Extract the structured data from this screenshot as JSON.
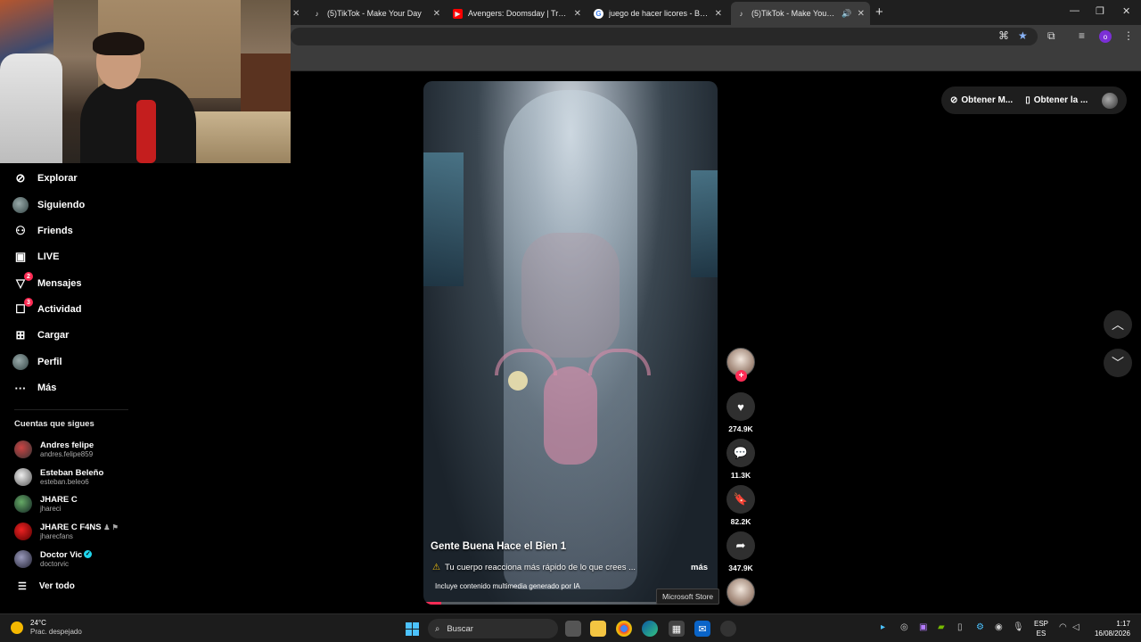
{
  "browser": {
    "tabs": [
      {
        "title": "(5)TikTok - Make Your Day",
        "icon": "tiktok-icon",
        "active": false
      },
      {
        "title": "Avengers: Doomsday | Tráiler O",
        "icon": "youtube-icon",
        "active": false
      },
      {
        "title": "juego de hacer licores - Buscar",
        "icon": "google-icon",
        "active": false
      },
      {
        "title": "(5)TikTok - Make Your Day",
        "icon": "tiktok-icon",
        "active": true
      }
    ],
    "new_tab": "+",
    "profile_initial": "o"
  },
  "sidebar": {
    "nav": [
      {
        "label": "Explorar",
        "icon": "compass-icon"
      },
      {
        "label": "Siguiendo",
        "icon": "avatar-icon"
      },
      {
        "label": "Friends",
        "icon": "people-icon"
      },
      {
        "label": "LIVE",
        "icon": "live-icon"
      },
      {
        "label": "Mensajes",
        "icon": "send-icon",
        "badge": "2"
      },
      {
        "label": "Actividad",
        "icon": "activity-icon",
        "badge": "3"
      },
      {
        "label": "Cargar",
        "icon": "upload-icon"
      },
      {
        "label": "Perfil",
        "icon": "profile-avatar-icon"
      },
      {
        "label": "Más",
        "icon": "more-icon"
      }
    ],
    "following_title": "Cuentas que sigues",
    "following": [
      {
        "name": "Andres felipe",
        "username": "andres.felipe859"
      },
      {
        "name": "Esteban Beleño",
        "username": "esteban.beleo6"
      },
      {
        "name": "JHARE C",
        "username": "jhareci"
      },
      {
        "name": "JHARE C F4NS",
        "username": "jharecfans"
      },
      {
        "name": "Doctor Vic",
        "username": "doctorvic"
      }
    ],
    "see_all": "Ver todo"
  },
  "video": {
    "caption": "Gente Buena Hace el Bien 1",
    "description": "Tu cuerpo reacciona más rápido de lo que crees ...",
    "more": "más",
    "ai_label": "Incluye contenido multimedia generado por IA",
    "progress": 0.06
  },
  "actions": {
    "likes": "274.9K",
    "comments": "11.3K",
    "saves": "82.2K",
    "shares": "347.9K"
  },
  "tooltip": "Microsoft Store",
  "top_actions": {
    "get_app_1": "Obtener M...",
    "get_app_2": "Obtener la ..."
  },
  "taskbar": {
    "temperature": "24°C",
    "weather": "Prac. despejado",
    "search_placeholder": "Buscar",
    "lang_1": "ESP",
    "lang_2": "ES",
    "time": "1:17",
    "date": "16/08/2026"
  },
  "colors": {
    "accent": "#fe2c55",
    "background": "#000000",
    "verified": "#20d5ec"
  }
}
